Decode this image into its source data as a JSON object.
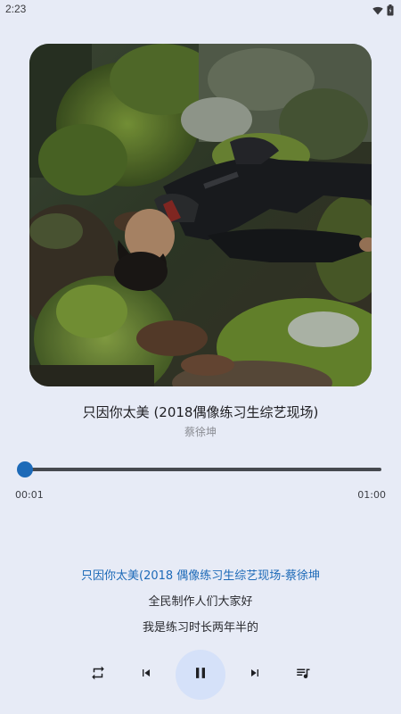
{
  "status_bar": {
    "time": "2:23",
    "icons": [
      "wifi-icon",
      "battery-icon"
    ]
  },
  "cover": {
    "description_icon": "album-cover-image"
  },
  "song": {
    "title": "只因你太美 (2018偶像练习生综艺现场)",
    "artist": "蔡徐坤"
  },
  "progress": {
    "current_time": "00:01",
    "total_time": "01:00",
    "fraction": 0.017
  },
  "lyrics": [
    {
      "text": "只因你太美(2018 偶像练习生综艺现场-蔡徐坤",
      "active": true
    },
    {
      "text": "全民制作人们大家好",
      "active": false
    },
    {
      "text": "我是练习时长两年半的",
      "active": false
    }
  ],
  "controls": {
    "icons": [
      "repeat-icon",
      "skip-previous-icon",
      "pause-icon",
      "skip-next-icon",
      "playlist-icon"
    ]
  },
  "colors": {
    "background": "#e7ebf6",
    "accent": "#1d6ab8",
    "play_button_bg": "#d5e1f9"
  }
}
